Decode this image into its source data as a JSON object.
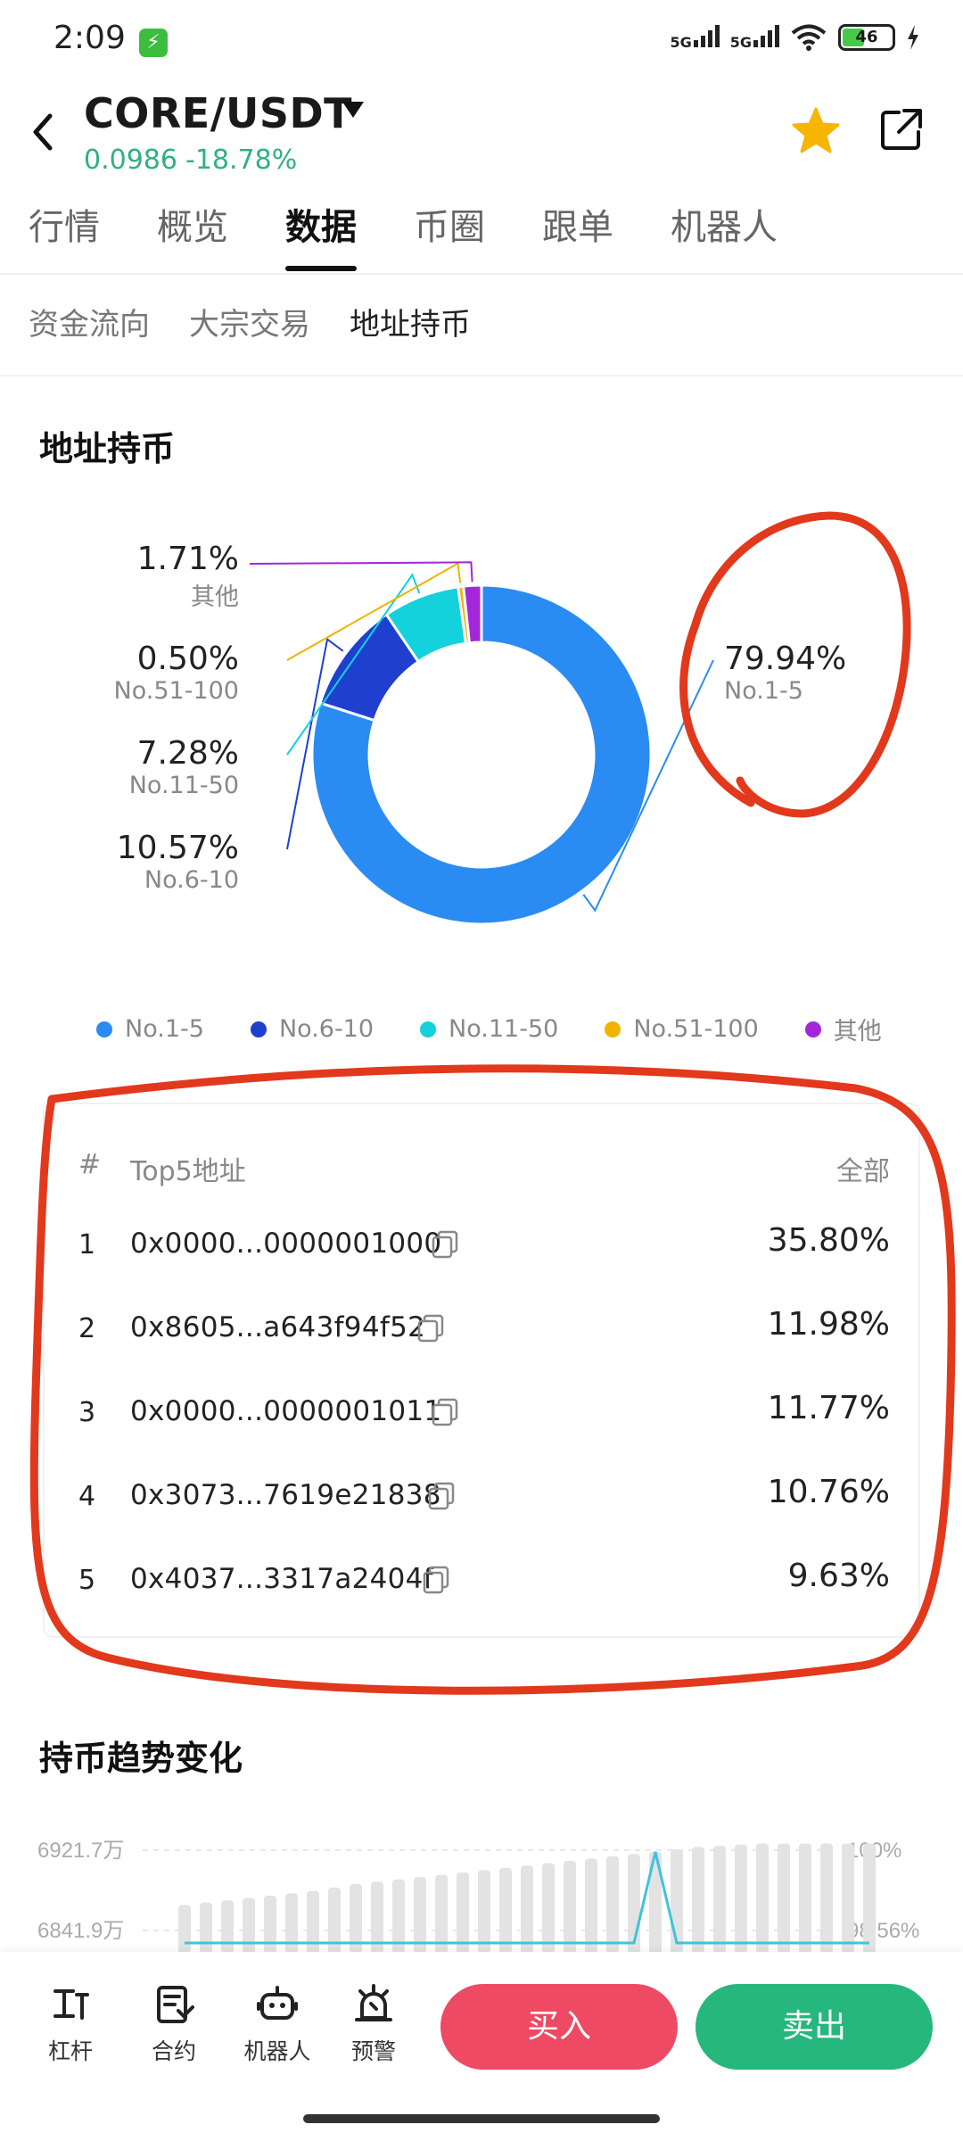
{
  "status": {
    "time": "2:09",
    "battery": "46",
    "signal1": "5G",
    "signal2": "5G"
  },
  "header": {
    "pair": "CORE/USDT",
    "price": "0.0986",
    "change": "-18.78%"
  },
  "main_tabs": [
    "行情",
    "概览",
    "数据",
    "币圈",
    "跟单",
    "机器人"
  ],
  "sub_tabs": [
    "资金流向",
    "大宗交易",
    "地址持币"
  ],
  "holdings": {
    "title": "地址持币",
    "segments": [
      {
        "pct": "79.94%",
        "name": "No.1-5",
        "value": 79.94,
        "color": "#2a8bf2"
      },
      {
        "pct": "10.57%",
        "name": "No.6-10",
        "value": 10.57,
        "color": "#1f3fcf"
      },
      {
        "pct": "7.28%",
        "name": "No.11-50",
        "value": 7.28,
        "color": "#13d2dc"
      },
      {
        "pct": "0.50%",
        "name": "No.51-100",
        "value": 0.5,
        "color": "#f0b400"
      },
      {
        "pct": "1.71%",
        "name": "其他",
        "value": 1.71,
        "color": "#a327d9"
      }
    ]
  },
  "chart_data": [
    {
      "type": "pie",
      "title": "地址持币",
      "categories": [
        "No.1-5",
        "No.6-10",
        "No.11-50",
        "No.51-100",
        "其他"
      ],
      "values": [
        79.94,
        10.57,
        7.28,
        0.5,
        1.71
      ],
      "legend": "bottom"
    },
    {
      "type": "bar",
      "title": "持币趋势变化",
      "y_left_ticks": [
        "6921.7万",
        "6841.9万"
      ],
      "y_right_ticks": [
        "100%",
        "98.56%"
      ],
      "series": [
        {
          "name": "holdings",
          "type": "bar",
          "values": [
            0.42,
            0.44,
            0.46,
            0.48,
            0.5,
            0.52,
            0.54,
            0.57,
            0.6,
            0.62,
            0.64,
            0.66,
            0.68,
            0.7,
            0.72,
            0.74,
            0.76,
            0.78,
            0.8,
            0.82,
            0.84,
            0.86,
            0.88,
            0.9,
            0.92,
            0.93,
            0.94,
            0.95,
            0.95,
            0.95,
            0.95,
            0.95,
            0.95
          ]
        },
        {
          "name": "ratio",
          "type": "line",
          "values": [
            0.2,
            0.2,
            0.2,
            0.2,
            0.2,
            0.2,
            0.2,
            0.2,
            0.2,
            0.2,
            0.2,
            0.2,
            0.2,
            0.2,
            0.2,
            0.2,
            0.2,
            0.2,
            0.2,
            0.2,
            0.2,
            0.2,
            0.2,
            0.2,
            0.2,
            0.2,
            0.2,
            0.2,
            0.2,
            0.2,
            0.2,
            0.2,
            0.2
          ]
        }
      ]
    }
  ],
  "top5": {
    "header_num": "#",
    "header_addr": "Top5地址",
    "header_filter": "全部",
    "rows": [
      {
        "n": "1",
        "addr": "0x0000...0000001000",
        "pct": "35.80%"
      },
      {
        "n": "2",
        "addr": "0x8605...a643f94f52",
        "pct": "11.98%"
      },
      {
        "n": "3",
        "addr": "0x0000...0000001011",
        "pct": "11.77%"
      },
      {
        "n": "4",
        "addr": "0x3073...7619e21838",
        "pct": "10.76%"
      },
      {
        "n": "5",
        "addr": "0x4037...3317a2404f",
        "pct": "9.63%"
      }
    ]
  },
  "trend": {
    "title": "持币趋势变化",
    "y_left": [
      "6921.7万",
      "6841.9万"
    ],
    "y_right": [
      "100%",
      "98.56%"
    ]
  },
  "bottom": {
    "items": [
      "杠杆",
      "合约",
      "机器人",
      "预警"
    ],
    "buy": "买入",
    "sell": "卖出"
  }
}
